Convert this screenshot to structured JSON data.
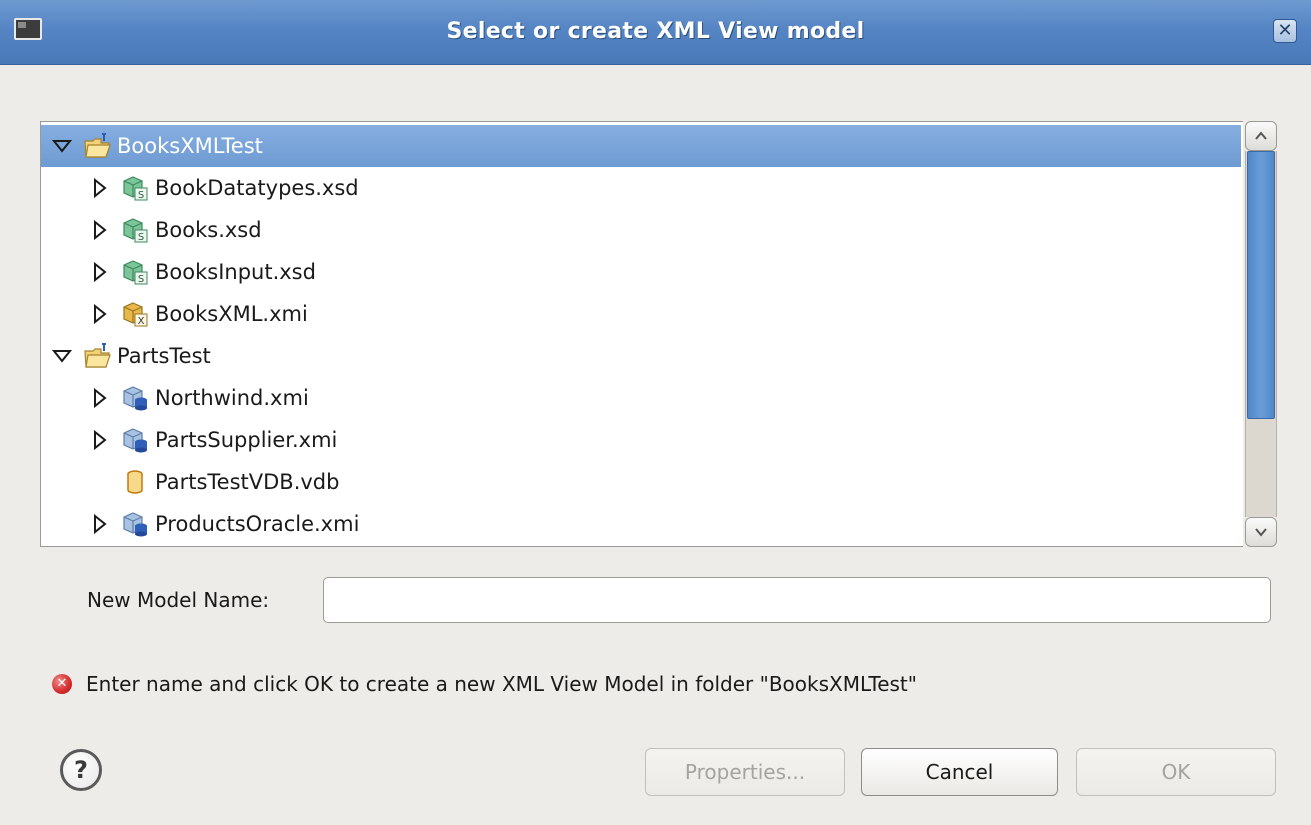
{
  "window": {
    "title": "Select or create XML View model",
    "close_glyph": "✕"
  },
  "tree": {
    "items": [
      {
        "label": "BooksXMLTest",
        "level": 0,
        "expanded": true,
        "has_children": true,
        "icon": "project-folder-icon",
        "selected": true
      },
      {
        "label": "BookDatatypes.xsd",
        "level": 1,
        "expanded": false,
        "has_children": true,
        "icon": "xsd-schema-icon",
        "selected": false
      },
      {
        "label": "Books.xsd",
        "level": 1,
        "expanded": false,
        "has_children": true,
        "icon": "xsd-schema-icon",
        "selected": false
      },
      {
        "label": "BooksInput.xsd",
        "level": 1,
        "expanded": false,
        "has_children": true,
        "icon": "xsd-schema-icon",
        "selected": false
      },
      {
        "label": "BooksXML.xmi",
        "level": 1,
        "expanded": false,
        "has_children": true,
        "icon": "xml-model-icon",
        "selected": false
      },
      {
        "label": "PartsTest",
        "level": 0,
        "expanded": true,
        "has_children": true,
        "icon": "project-folder-icon",
        "selected": false
      },
      {
        "label": "Northwind.xmi",
        "level": 1,
        "expanded": false,
        "has_children": true,
        "icon": "relational-model-icon",
        "selected": false
      },
      {
        "label": "PartsSupplier.xmi",
        "level": 1,
        "expanded": false,
        "has_children": true,
        "icon": "relational-model-icon",
        "selected": false
      },
      {
        "label": "PartsTestVDB.vdb",
        "level": 1,
        "expanded": false,
        "has_children": false,
        "icon": "vdb-icon",
        "selected": false
      },
      {
        "label": "ProductsOracle.xmi",
        "level": 1,
        "expanded": false,
        "has_children": true,
        "icon": "relational-model-icon",
        "selected": false
      }
    ]
  },
  "form": {
    "name_label": "New Model Name:",
    "name_value": "",
    "name_placeholder": ""
  },
  "message": {
    "text": "Enter name and click OK to create a new XML View Model in folder \"BooksXMLTest\"",
    "icon": "error-icon"
  },
  "help": {
    "glyph": "?"
  },
  "buttons": {
    "properties": "Properties...",
    "cancel": "Cancel",
    "ok": "OK"
  },
  "colors": {
    "title_bar": "#5585c4",
    "selection": "#7ba6d9",
    "scroll_thumb": "#5a8fcd",
    "error": "#d42a2a"
  }
}
